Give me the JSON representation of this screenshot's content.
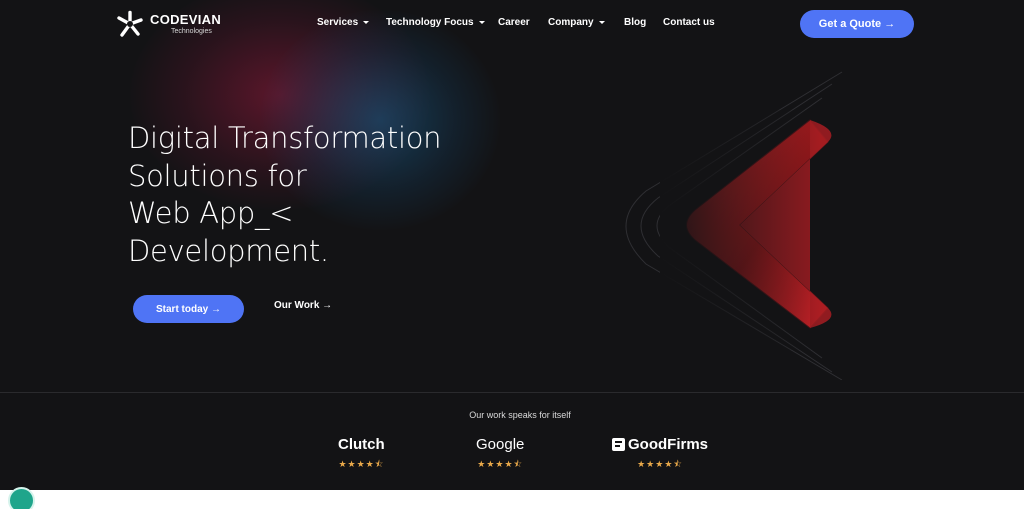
{
  "brand": {
    "name": "CODEVIAN",
    "sub": "Technologies",
    "logo_icon": "starburst-logo"
  },
  "nav": {
    "items": [
      {
        "label": "Services",
        "has_dropdown": true
      },
      {
        "label": "Technology Focus",
        "has_dropdown": true
      },
      {
        "label": "Career",
        "has_dropdown": false
      },
      {
        "label": "Company",
        "has_dropdown": true
      },
      {
        "label": "Blog",
        "has_dropdown": false
      },
      {
        "label": "Contact us",
        "has_dropdown": false
      }
    ],
    "cta": "Get a Quote →"
  },
  "hero": {
    "lines": [
      "Digital Transformation",
      "Solutions for",
      "Web App_<",
      "Development."
    ],
    "primary_cta": "Start today →",
    "secondary_cta": "Our Work →"
  },
  "reviews": {
    "tagline": "Our work speaks for itself",
    "platforms": [
      {
        "name": "Clutch",
        "rating": 4.5,
        "stars": "★★★★⯪"
      },
      {
        "name": "Google",
        "rating": 4.5,
        "stars": "★★★★⯪"
      },
      {
        "name": "GoodFirms",
        "rating": 4.5,
        "stars": "★★★★⯪"
      }
    ]
  },
  "colors": {
    "background": "#131315",
    "accent": "#4f74f5",
    "star": "#e9a94a",
    "glow_red": "#96193c",
    "glow_blue": "#195f8c",
    "chat": "#1fa58b"
  },
  "icons": {
    "chat": "chat-bubble-icon",
    "dropdown": "chevron-down-icon",
    "deco": "chevron-left-graphic"
  }
}
